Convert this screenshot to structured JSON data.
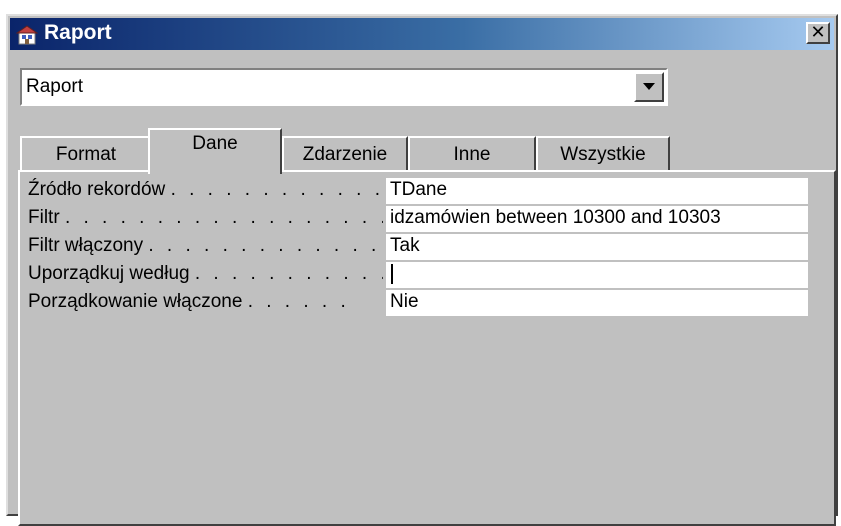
{
  "window": {
    "title": "Raport",
    "close_label": "✕"
  },
  "object_selector": {
    "value": "Raport"
  },
  "tabs": [
    {
      "label": "Format",
      "active": false
    },
    {
      "label": "Dane",
      "active": true
    },
    {
      "label": "Zdarzenie",
      "active": false
    },
    {
      "label": "Inne",
      "active": false
    },
    {
      "label": "Wszystkie",
      "active": false
    }
  ],
  "properties": [
    {
      "label": "Źródło rekordów",
      "dots": ". . . . . . . . . . . .",
      "value": "TDane"
    },
    {
      "label": "Filtr",
      "dots": ". . . . . . . . . . . . . . . . . . . . .",
      "value": "idzamówien between 10300 and 10303"
    },
    {
      "label": "Filtr włączony",
      "dots": ". . . . . . . . . . . . . .",
      "value": "Tak"
    },
    {
      "label": "Uporządkuj według",
      "dots": ". . . . . . . . . . .",
      "value": ""
    },
    {
      "label": "Porządkowanie włączone",
      "dots": ". . . . . .",
      "value": "Nie"
    }
  ]
}
